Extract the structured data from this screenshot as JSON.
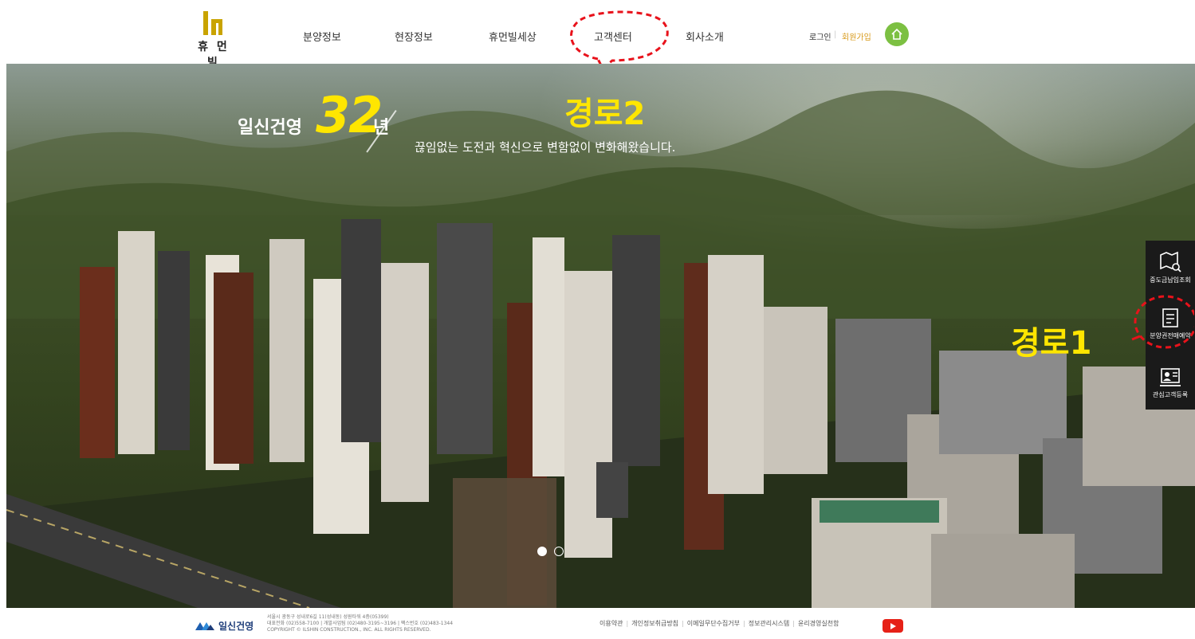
{
  "header": {
    "logo_text": "휴 먼 빌",
    "nav": [
      {
        "label": "분양정보"
      },
      {
        "label": "현장정보"
      },
      {
        "label": "휴먼빌세상"
      },
      {
        "label": "고객센터"
      },
      {
        "label": "회사소개"
      }
    ],
    "login": "로그인",
    "separator": "|",
    "join": "회원가입"
  },
  "hero": {
    "slogan_prefix": "일신건영",
    "slogan_number": "32",
    "slogan_unit": "년",
    "slogan_sub": "끊임없는 도전과 혁신으로 변함없이 변화해왔습니다.",
    "annotation_route2": "경로2",
    "annotation_route1": "경로1",
    "slide_count": 2,
    "active_slide": 1
  },
  "quick_menu": [
    {
      "label": "중도금납입조회",
      "icon": "map-search-icon"
    },
    {
      "label": "분양권전매예약",
      "icon": "document-edit-icon"
    },
    {
      "label": "관심고객등록",
      "icon": "person-card-icon"
    }
  ],
  "footer": {
    "company": "일신건영",
    "address_line1": "서울시 광동구 성내로6길 11(성내동) 성원타워 4층(05399)",
    "address_line2": "대표전화 (02)558-7100 | 개발사업팀 (02)480-3195~3196 | 팩스번호 (02)483-1344",
    "address_line3": "COPYRIGHT © ILSHIN CONSTRUCTION., INC. ALL RIGHTS RESERVED.",
    "links": [
      {
        "label": "이용약관"
      },
      {
        "label": "개인정보취급방침"
      },
      {
        "label": "이메일무단수집거부"
      },
      {
        "label": "정보관리시스템"
      },
      {
        "label": "윤리경영실천함"
      }
    ]
  },
  "colors": {
    "accent_yellow": "#ffe600",
    "home_green": "#7cc042",
    "annotation_red": "#e8121b",
    "quick_menu_bg": "#1a1a1a",
    "youtube_red": "#e62117",
    "brand_gold": "#c9a300"
  }
}
